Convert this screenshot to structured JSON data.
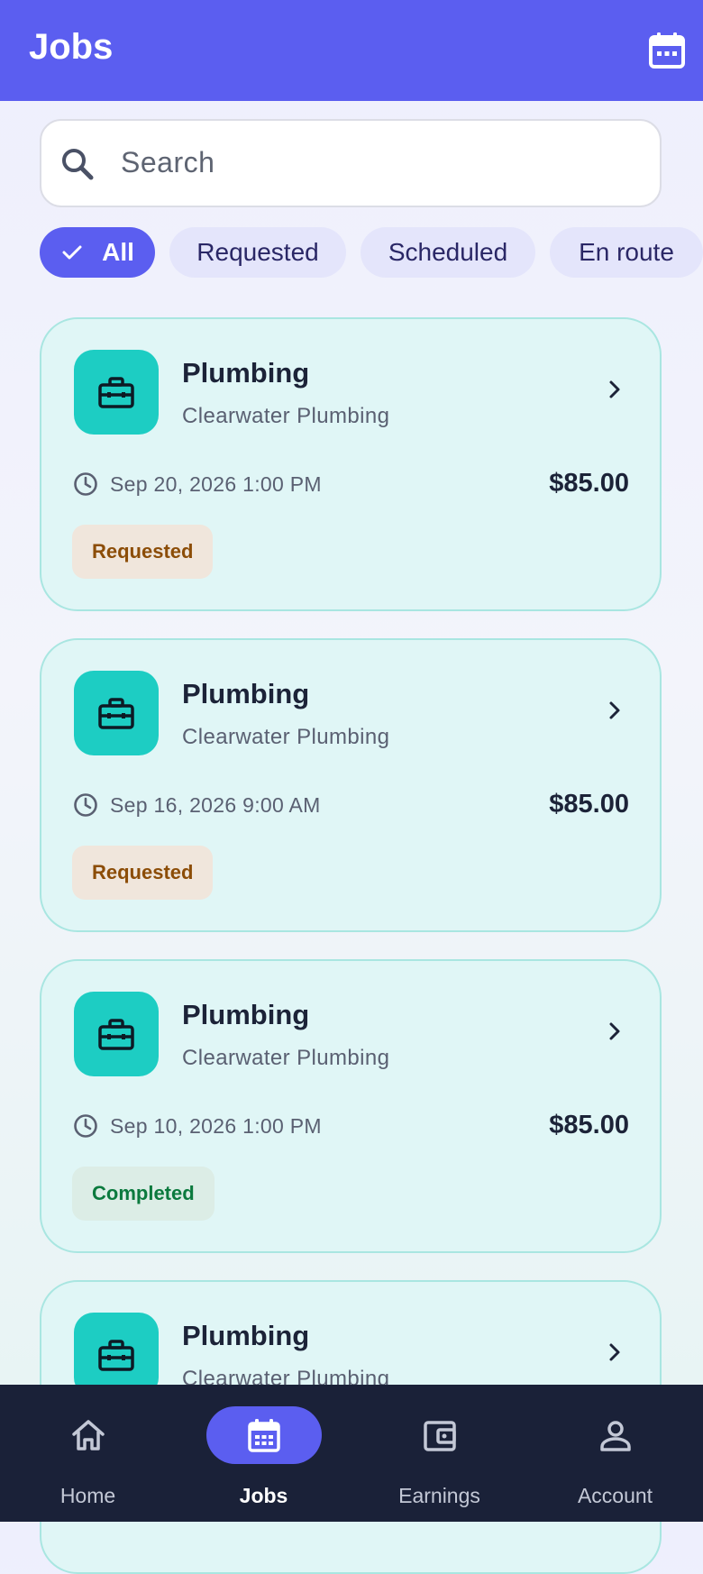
{
  "header": {
    "title": "Jobs",
    "action_icon": "calendar-icon"
  },
  "search": {
    "placeholder": "Search"
  },
  "filters": [
    {
      "label": "All",
      "selected": true
    },
    {
      "label": "Requested",
      "selected": false
    },
    {
      "label": "Scheduled",
      "selected": false
    },
    {
      "label": "En route",
      "selected": false
    }
  ],
  "jobs": [
    {
      "category": "Plumbing",
      "vendor": "Clearwater Plumbing",
      "datetime": "Sep 20, 2026 1:00 PM",
      "price": "$85.00",
      "status": "Requested"
    },
    {
      "category": "Plumbing",
      "vendor": "Clearwater Plumbing",
      "datetime": "Sep 16, 2026 9:00 AM",
      "price": "$85.00",
      "status": "Requested"
    },
    {
      "category": "Plumbing",
      "vendor": "Clearwater Plumbing",
      "datetime": "Sep 10, 2026 1:00 PM",
      "price": "$85.00",
      "status": "Completed"
    },
    {
      "category": "Plumbing",
      "vendor": "Clearwater Plumbing"
    }
  ],
  "nav": [
    {
      "label": "Home",
      "icon": "home-icon"
    },
    {
      "label": "Jobs",
      "icon": "calendar-icon",
      "active": true
    },
    {
      "label": "Earnings",
      "icon": "wallet-icon"
    },
    {
      "label": "Account",
      "icon": "person-icon"
    }
  ],
  "colors": {
    "primary": "#5b5ef0",
    "tile": "#1dcdc3",
    "card_bg": "#e0f6f6",
    "nav_bg": "#1a2138",
    "requested": "#8c4d07",
    "completed": "#0b7a3e"
  }
}
